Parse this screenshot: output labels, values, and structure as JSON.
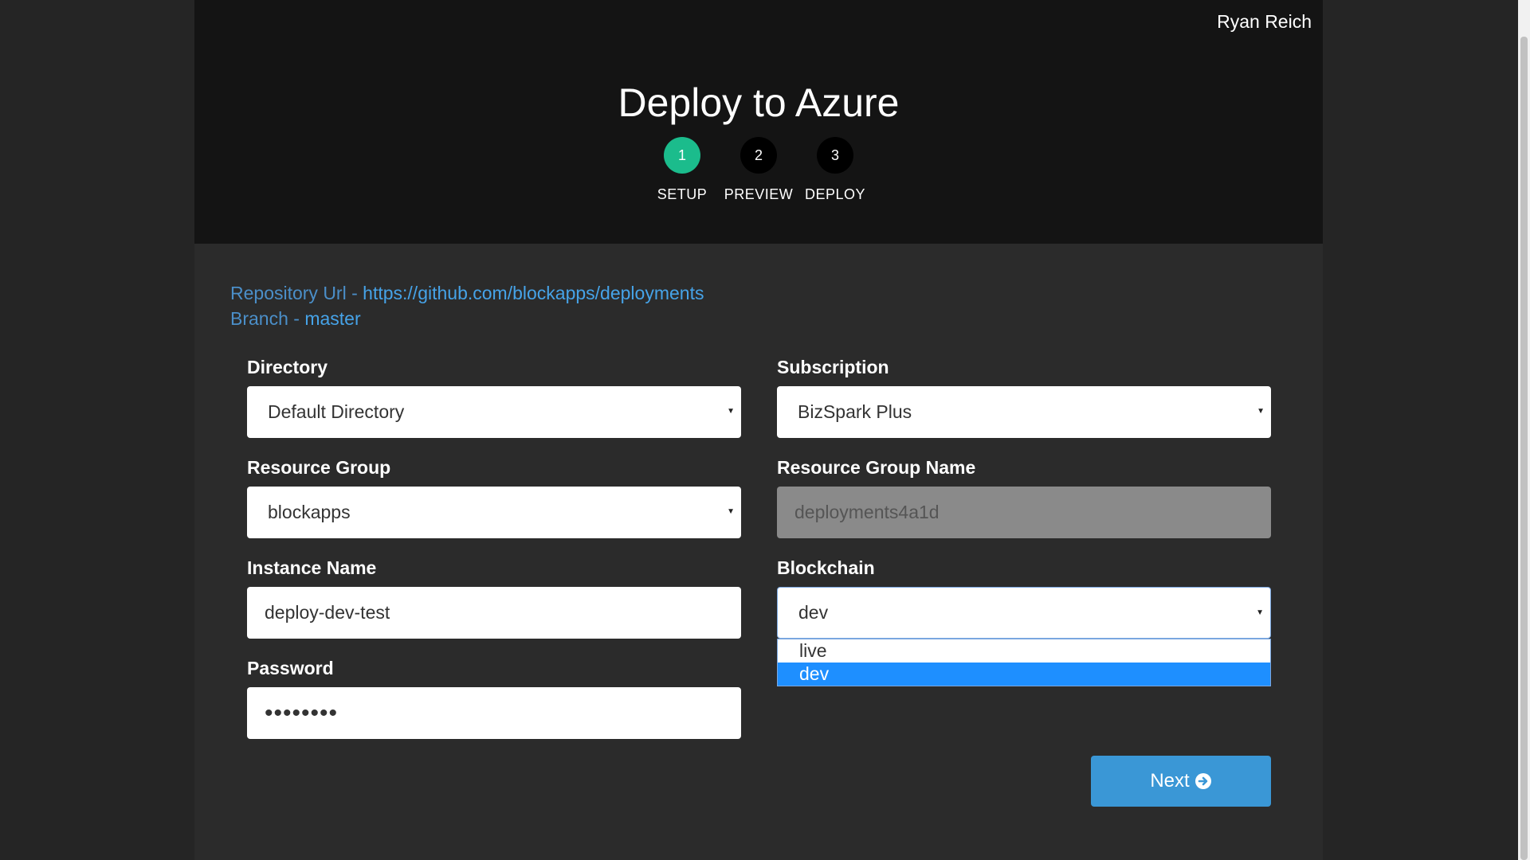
{
  "header": {
    "user_name": "Ryan Reich",
    "title": "Deploy to Azure",
    "steps": [
      {
        "number": "1",
        "label": "SETUP",
        "active": true
      },
      {
        "number": "2",
        "label": "PREVIEW",
        "active": false
      },
      {
        "number": "3",
        "label": "DEPLOY",
        "active": false
      }
    ]
  },
  "repo": {
    "url_label": "Repository Url - ",
    "url_value": "https://github.com/blockapps/deployments",
    "branch_label": "Branch - ",
    "branch_value": "master"
  },
  "form": {
    "directory": {
      "label": "Directory",
      "value": "Default Directory"
    },
    "subscription": {
      "label": "Subscription",
      "value": "BizSpark Plus"
    },
    "resource_group": {
      "label": "Resource Group",
      "value": "blockapps"
    },
    "resource_group_name": {
      "label": "Resource Group Name",
      "value": "deployments4a1d"
    },
    "instance_name": {
      "label": "Instance Name",
      "value": "deploy-dev-test"
    },
    "blockchain": {
      "label": "Blockchain",
      "value": "dev",
      "options": [
        "live",
        "dev"
      ],
      "selected": "dev"
    },
    "password": {
      "label": "Password",
      "value": "••••••••"
    }
  },
  "actions": {
    "next_label": "Next"
  },
  "colors": {
    "active_step": "#1bbc8c",
    "link": "#46a3e8",
    "primary_button": "#3a97d6",
    "option_highlight": "#1e8fff"
  }
}
